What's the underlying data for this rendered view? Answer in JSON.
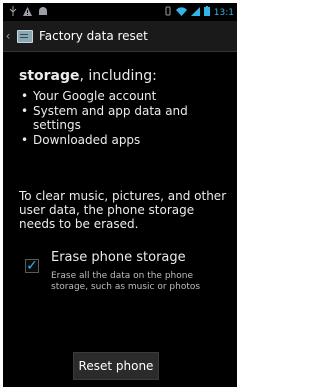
{
  "status_bar": {
    "time": "13:1",
    "icons": [
      "usb-icon",
      "warning-icon",
      "android-icon",
      "vibrate-icon",
      "wifi-icon",
      "signal-icon",
      "battery-icon"
    ]
  },
  "action_bar": {
    "title": "Factory data reset",
    "back_icon": "chevron-left-icon",
    "app_icon": "settings-icon"
  },
  "content": {
    "intro_bold": "storage",
    "intro_rest": ", including:",
    "bullets": [
      {
        "dot": "•",
        "text": "Your Google account"
      },
      {
        "dot": "•",
        "text": "System and app data and settings"
      },
      {
        "dot": "•",
        "text": "Downloaded apps"
      }
    ],
    "note": "To clear music, pictures, and other user data, the phone storage needs to be erased.",
    "erase": {
      "title": "Erase phone storage",
      "desc": "Erase all the data on the phone storage, such as music or photos",
      "checked": true
    },
    "reset_button": "Reset phone"
  },
  "colors": {
    "accent": "#33b5e5",
    "background": "#000000",
    "action_bar": "#1a1a1a"
  }
}
